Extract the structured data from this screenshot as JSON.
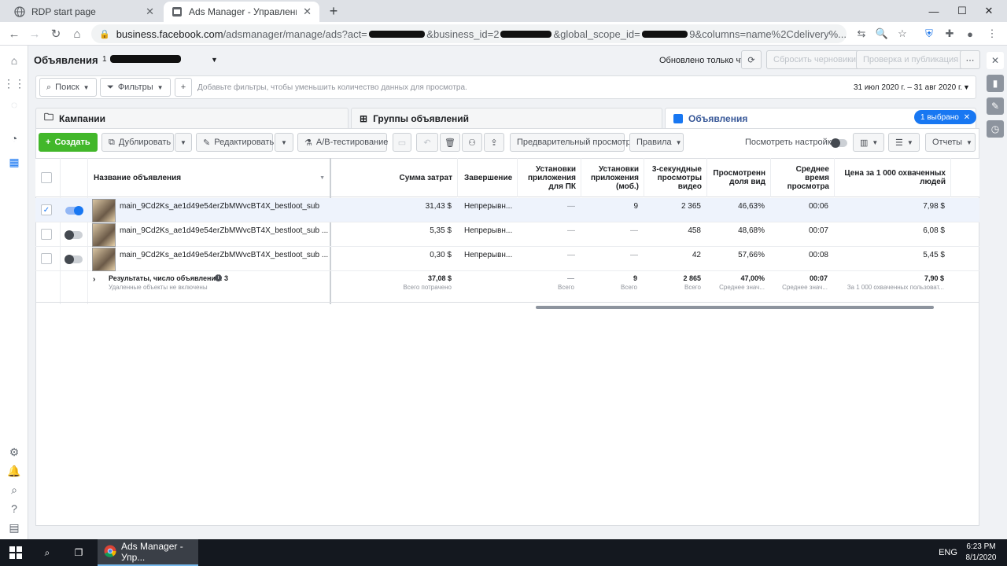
{
  "browser": {
    "tabs": [
      {
        "label": "RDP start page",
        "icon": "globe-icon"
      },
      {
        "label": "Ads Manager - Управление рекл",
        "icon": "ads-manager-icon"
      }
    ],
    "url_host": "business.facebook.com",
    "url_rest": "/adsmanager/manage/ads?act=",
    "url_tail": "&business_id=2",
    "url_tail2": "&global_scope_id=",
    "url_tail3": "9&columns=name%2Cdelivery%..."
  },
  "header": {
    "title": "Объявления",
    "account_prefix": "1",
    "updated": "Обновлено только что",
    "discard": "Сбросить черновики",
    "review": "Проверка и публикация"
  },
  "filterbar": {
    "search": "Поиск",
    "filters": "Фильтры",
    "placeholder": "Добавьте фильтры, чтобы уменьшить количество данных для просмотра.",
    "date_range": "31 июл 2020 г. – 31 авг 2020 г."
  },
  "levels": {
    "campaigns": "Кампании",
    "adsets": "Группы объявлений",
    "ads": "Объявления",
    "selected": "1 выбрано"
  },
  "actions": {
    "create": "Создать",
    "duplicate": "Дублировать",
    "edit": "Редактировать",
    "ab_test": "A/B-тестирование",
    "preview": "Предварительный просмотр",
    "rules": "Правила",
    "view_settings": "Посмотреть настройки",
    "reports": "Отчеты"
  },
  "table": {
    "headers": {
      "name": "Название объявления",
      "spend": "Сумма затрат",
      "end": "Завершение",
      "installs_pc": "Установки\nприложения\nдля ПК",
      "installs_mobile": "Установки\nприложения\n(моб.)",
      "views3s": "3-секундные\nпросмотры\nвидео",
      "watched": "Просмотренн\nдоля вид",
      "avg_time": "Среднее\nвремя\nпросмотра",
      "cpm_reach": "Цена за 1 000 охваченных\nлюдей"
    },
    "rows": [
      {
        "name": "main_9Cd2Ks_ae1d49e54erZbMWvcBT4X_bestloot_sub",
        "spend": "31,43 $",
        "end": "Непрерывн...",
        "installs_pc": "—",
        "installs_mobile": "9",
        "views3s": "2 365",
        "watched": "46,63%",
        "avg_time": "00:06",
        "cpm_reach": "7,98 $",
        "active": true,
        "selected": true
      },
      {
        "name": "main_9Cd2Ks_ae1d49e54erZbMWvcBT4X_bestloot_sub ...",
        "spend": "5,35 $",
        "end": "Непрерывн...",
        "installs_pc": "—",
        "installs_mobile": "—",
        "views3s": "458",
        "watched": "48,68%",
        "avg_time": "00:07",
        "cpm_reach": "6,08 $",
        "active": false,
        "selected": false
      },
      {
        "name": "main_9Cd2Ks_ae1d49e54erZbMWvcBT4X_bestloot_sub ...",
        "spend": "0,30 $",
        "end": "Непрерывн...",
        "installs_pc": "—",
        "installs_mobile": "—",
        "views3s": "42",
        "watched": "57,66%",
        "avg_time": "00:08",
        "cpm_reach": "5,45 $",
        "active": false,
        "selected": false
      }
    ],
    "totals": {
      "label": "Результаты, число объявлений: 3",
      "sublabel": "Удаленные объекты не включены",
      "spend": "37,08 $",
      "spend_sub": "Всего потрачено",
      "installs_pc": "—",
      "installs_pc_sub": "Всего",
      "installs_mobile": "9",
      "installs_mobile_sub": "Всего",
      "views3s": "2 865",
      "views3s_sub": "Всего",
      "watched": "47,00%",
      "watched_sub": "Среднее знач...",
      "avg_time": "00:07",
      "avg_time_sub": "Среднее знач...",
      "cpm_reach": "7,90 $",
      "cpm_reach_sub": "За 1 000 охваченных пользоват..."
    }
  },
  "taskbar": {
    "app": "Ads Manager - Упр...",
    "lang": "ENG",
    "time": "6:23 PM",
    "date": "8/1/2020"
  }
}
